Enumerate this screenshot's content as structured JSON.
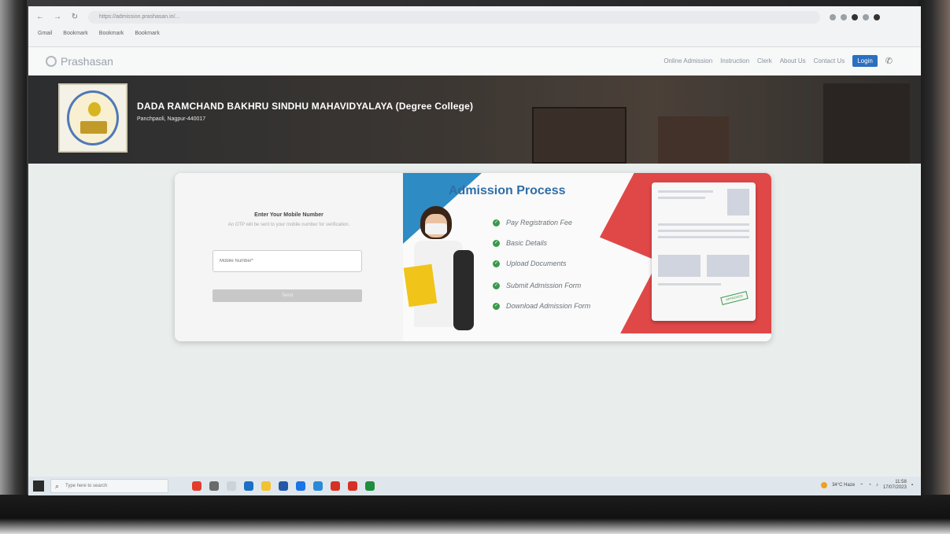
{
  "browser": {
    "address": "https://admission.prashasan.in/...",
    "bookmarks": [
      "Gmail",
      "Bookmark",
      "Bookmark",
      "Bookmark"
    ]
  },
  "site": {
    "brand": "Prashasan",
    "nav": [
      "Online Admission",
      "Instruction",
      "Clerk",
      "About Us",
      "Contact Us"
    ],
    "login_label": "Login"
  },
  "college": {
    "name": "DADA RAMCHAND BAKHRU SINDHU MAHAVIDYALAYA (Degree College)",
    "address": "Panchpaoli, Nagpur-440017"
  },
  "form": {
    "title": "Enter Your Mobile Number",
    "subtitle": "An OTP will be sent to your mobile number for verification.",
    "mobile_placeholder": "Mobile Number*",
    "submit_label": "Send"
  },
  "promo": {
    "title": "Admission Process",
    "steps": [
      "Pay Registration Fee",
      "Basic Details",
      "Upload Documents",
      "Submit Admission Form",
      "Download Admission Form"
    ],
    "stamp": "APPROVED"
  },
  "taskbar": {
    "search_placeholder": "Type here to search",
    "weather": "34°C Haze",
    "time": "11:58",
    "date": "17/07/2023"
  }
}
